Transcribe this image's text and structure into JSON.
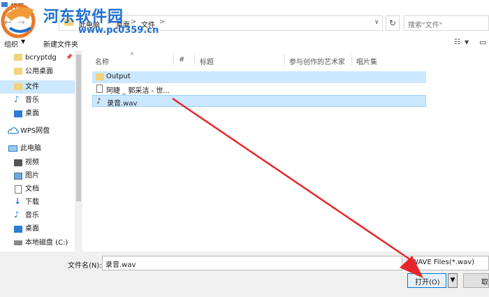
{
  "window": {
    "title": "打开"
  },
  "watermark": {
    "title": "河东软件园",
    "url": "www.pc0359.cn"
  },
  "address": {
    "crumbs": [
      "此电脑",
      "桌面",
      "文件"
    ],
    "separator": ">"
  },
  "search": {
    "placeholder": "搜索\"文件\""
  },
  "toolbar": {
    "organize": "组织",
    "new_folder": "新建文件夹"
  },
  "sidebar": {
    "items": [
      {
        "label": "bcryptdg",
        "icon": "folder-icon"
      },
      {
        "label": "公用桌面",
        "icon": "folder-icon"
      },
      {
        "label": "文件",
        "icon": "folder-icon",
        "selected": true
      },
      {
        "label": "音乐",
        "icon": "music-icon"
      },
      {
        "label": "桌面",
        "icon": "desktop-icon"
      },
      {
        "label": "WPS网盘",
        "icon": "cloud-icon"
      },
      {
        "label": "此电脑",
        "icon": "computer-icon"
      },
      {
        "label": "视频",
        "icon": "video-icon"
      },
      {
        "label": "图片",
        "icon": "picture-icon"
      },
      {
        "label": "文档",
        "icon": "document-icon"
      },
      {
        "label": "下载",
        "icon": "download-icon"
      },
      {
        "label": "音乐",
        "icon": "music-icon"
      },
      {
        "label": "桌面",
        "icon": "desktop-icon"
      },
      {
        "label": "本地磁盘 (C:)",
        "icon": "drive-icon"
      }
    ]
  },
  "columns": [
    "名称",
    "#",
    "标题",
    "参与创作的艺术家",
    "唱片集"
  ],
  "files": [
    {
      "name": "Output",
      "type": "folder"
    },
    {
      "name": "阿睫 _ 郭采洁 - 世...",
      "type": "file"
    },
    {
      "name": "录音.wav",
      "type": "audio",
      "selected": true
    }
  ],
  "footer": {
    "filename_label": "文件名(N):",
    "filename_value": "录音.wav",
    "filetype_value": "WAVE Files(*.wav)",
    "open_label": "打开(O)",
    "cancel_label": "取"
  },
  "colors": {
    "accent": "#0078d7",
    "selection": "#cce8ff",
    "annotation_arrow": "#e8262a",
    "watermark": "#1f6fd1"
  }
}
